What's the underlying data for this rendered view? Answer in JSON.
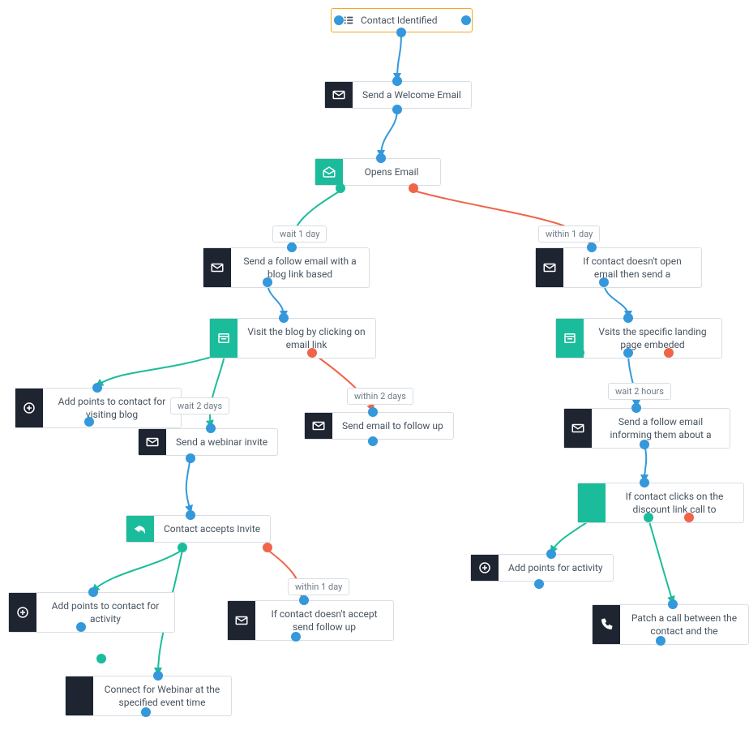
{
  "start": {
    "label": "Contact Identified"
  },
  "nodes": {
    "welcome": {
      "label": "Send a Welcome Email"
    },
    "opens": {
      "label": "Opens Email"
    },
    "followBlog": {
      "label": "Send a follow email with a blog link based"
    },
    "noOpen": {
      "label": "If contact doesn't open email then send a"
    },
    "visitBlog": {
      "label": "Visit the blog by clicking on email link"
    },
    "visitLanding": {
      "label": "Vsits the specific landing page embeded"
    },
    "pointsBlog": {
      "label": "Add points to contact for visiting blog"
    },
    "emailFollow": {
      "label": "Send email to follow up"
    },
    "followDisc": {
      "label": "Send a follow email informing them about a"
    },
    "webinarInv": {
      "label": "Send a webinar invite"
    },
    "discClick": {
      "label": "If contact clicks on the discount link call to"
    },
    "accepts": {
      "label": "Contact accepts Invite"
    },
    "pointsAct1": {
      "label": "Add points for activity"
    },
    "patchCall": {
      "label": "Patch a call between the contact and the"
    },
    "pointsAct2": {
      "label": "Add points to contact for activity"
    },
    "noAccept": {
      "label": "If contact doesn't accept send follow up"
    },
    "connectWeb": {
      "label": "Connect for Webinar at the specified event time"
    }
  },
  "badges": {
    "wait1day": "wait 1 day",
    "within1day": "within 1 day",
    "wait2days": "wait 2 days",
    "within2days": "within 2 days",
    "wait2hours": "wait 2 hours",
    "within1dayB": "within 1 day"
  }
}
